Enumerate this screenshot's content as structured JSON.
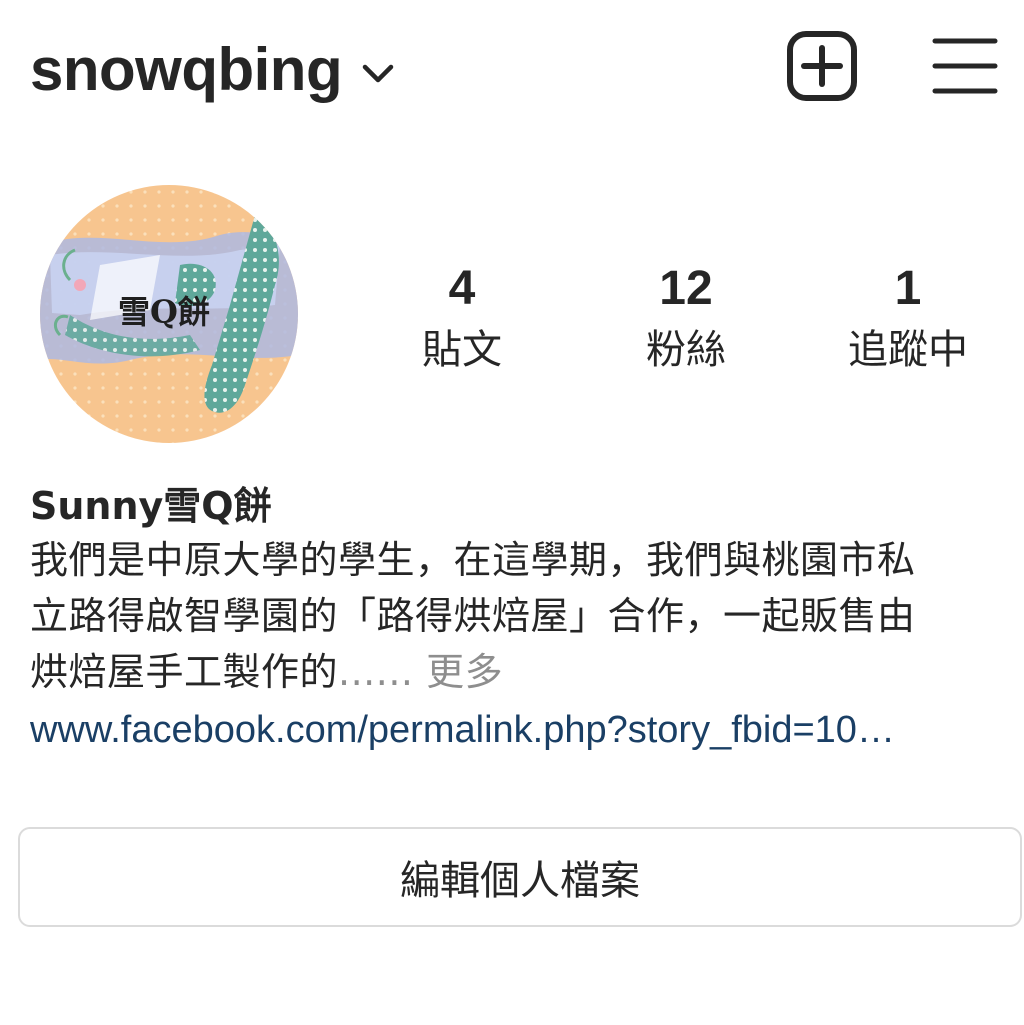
{
  "header": {
    "username": "snowqbing"
  },
  "profile": {
    "avatar_text": "雪Q餅",
    "stats": [
      {
        "value": "4",
        "label": "貼文"
      },
      {
        "value": "12",
        "label": "粉絲"
      },
      {
        "value": "1",
        "label": "追蹤中"
      }
    ],
    "display_name": "Sunny雪Q餅",
    "bio_lines": [
      "我們是中原大學的學生，在這學期，我們與桃園市私",
      "立路得啟智學園的「路得烘焙屋」合作，一起販售由",
      "烘焙屋手工製作的"
    ],
    "bio_ellipsis": "......",
    "more_label": " 更多",
    "link": "www.facebook.com/permalink.php?story_fbid=10…"
  },
  "actions": {
    "edit_profile_label": "編輯個人檔案"
  }
}
